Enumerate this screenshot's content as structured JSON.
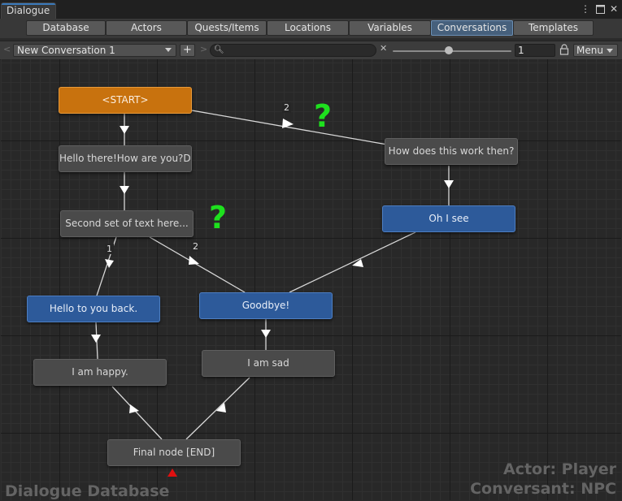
{
  "window": {
    "title": "Dialogue"
  },
  "tabs": [
    {
      "label": "Database",
      "active": false
    },
    {
      "label": "Actors",
      "active": false
    },
    {
      "label": "Quests/Items",
      "active": false
    },
    {
      "label": "Locations",
      "active": false
    },
    {
      "label": "Variables",
      "active": false
    },
    {
      "label": "Conversations",
      "active": true
    },
    {
      "label": "Templates",
      "active": false
    }
  ],
  "toolbar": {
    "conversation": "New Conversation 1",
    "add_label": "+",
    "search_value": "",
    "zoom_value": "1",
    "menu_label": "Menu",
    "zoom_level": 0.47
  },
  "nodes": {
    "start": "<START>",
    "hello_there": "Hello there!How are you?Do",
    "how_does": "How does this work then?",
    "oh_i_see": "Oh I see",
    "second_set": "Second set of text here...",
    "hello_back": "Hello to you back.",
    "goodbye": "Goodbye!",
    "happy": "I am happy.",
    "sad": "I am sad",
    "final": "Final node [END]"
  },
  "edge_labels": {
    "start_2": "2",
    "second_1": "1",
    "second_2": "2"
  },
  "annotations": {
    "question_mark": "?"
  },
  "overlay": {
    "database_name": "Dialogue Database",
    "actor": "Actor: Player",
    "conversant": "Conversant: NPC"
  },
  "colors": {
    "start_node": "#c8720e",
    "npc_node": "#2d5a9a",
    "player_node": "#4a4a4a",
    "annotation": "#1ee01e",
    "end_marker": "#e01010",
    "active_tab": "#46607c"
  }
}
